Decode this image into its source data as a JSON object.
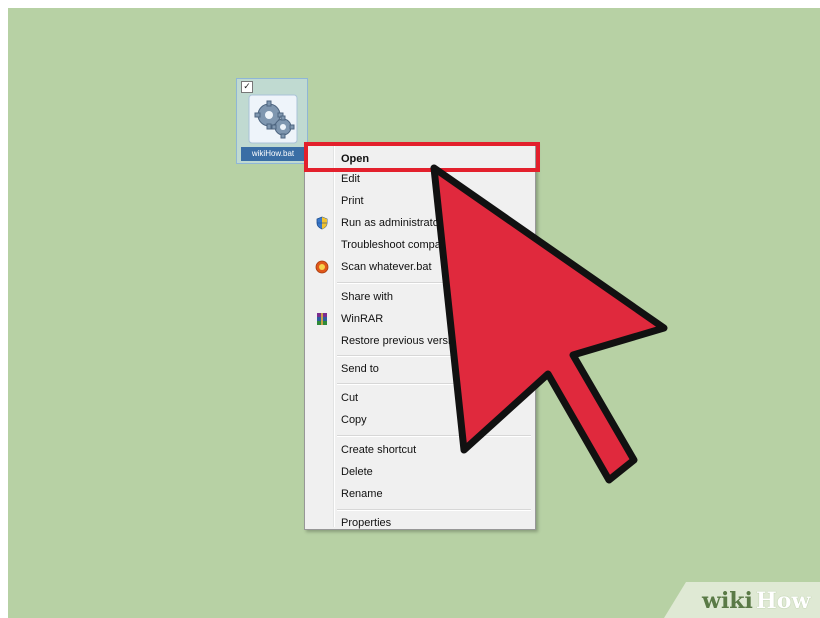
{
  "desktop": {
    "background_color": "#b7d1a4",
    "file_icon": {
      "icon": "gears-icon",
      "label": "wikiHow.bat",
      "checked": true
    }
  },
  "context_menu": {
    "items": [
      {
        "label": "Open",
        "bold": true,
        "icon": null
      },
      {
        "label": "Edit",
        "icon": null
      },
      {
        "label": "Print",
        "icon": null
      },
      {
        "label": "Run as administrator",
        "icon": "shield-icon"
      },
      {
        "label": "Troubleshoot compatibility",
        "icon": null
      },
      {
        "label": "Scan whatever.bat",
        "icon": "antivirus-icon"
      },
      {
        "label": "Share with",
        "icon": null
      },
      {
        "label": "WinRAR",
        "icon": "winrar-icon"
      },
      {
        "label": "Restore previous versions",
        "icon": null
      },
      {
        "label": "Send to",
        "icon": null
      },
      {
        "label": "Cut",
        "icon": null
      },
      {
        "label": "Copy",
        "icon": null
      },
      {
        "label": "Create shortcut",
        "icon": null
      },
      {
        "label": "Delete",
        "icon": null
      },
      {
        "label": "Rename",
        "icon": null
      },
      {
        "label": "Properties",
        "icon": null
      }
    ]
  },
  "annotation": {
    "highlight_color": "#e3202c",
    "arrow_color": "#e0293d",
    "highlighted_item": "Open"
  },
  "watermark": {
    "part1": "wiki",
    "part2": "How"
  }
}
